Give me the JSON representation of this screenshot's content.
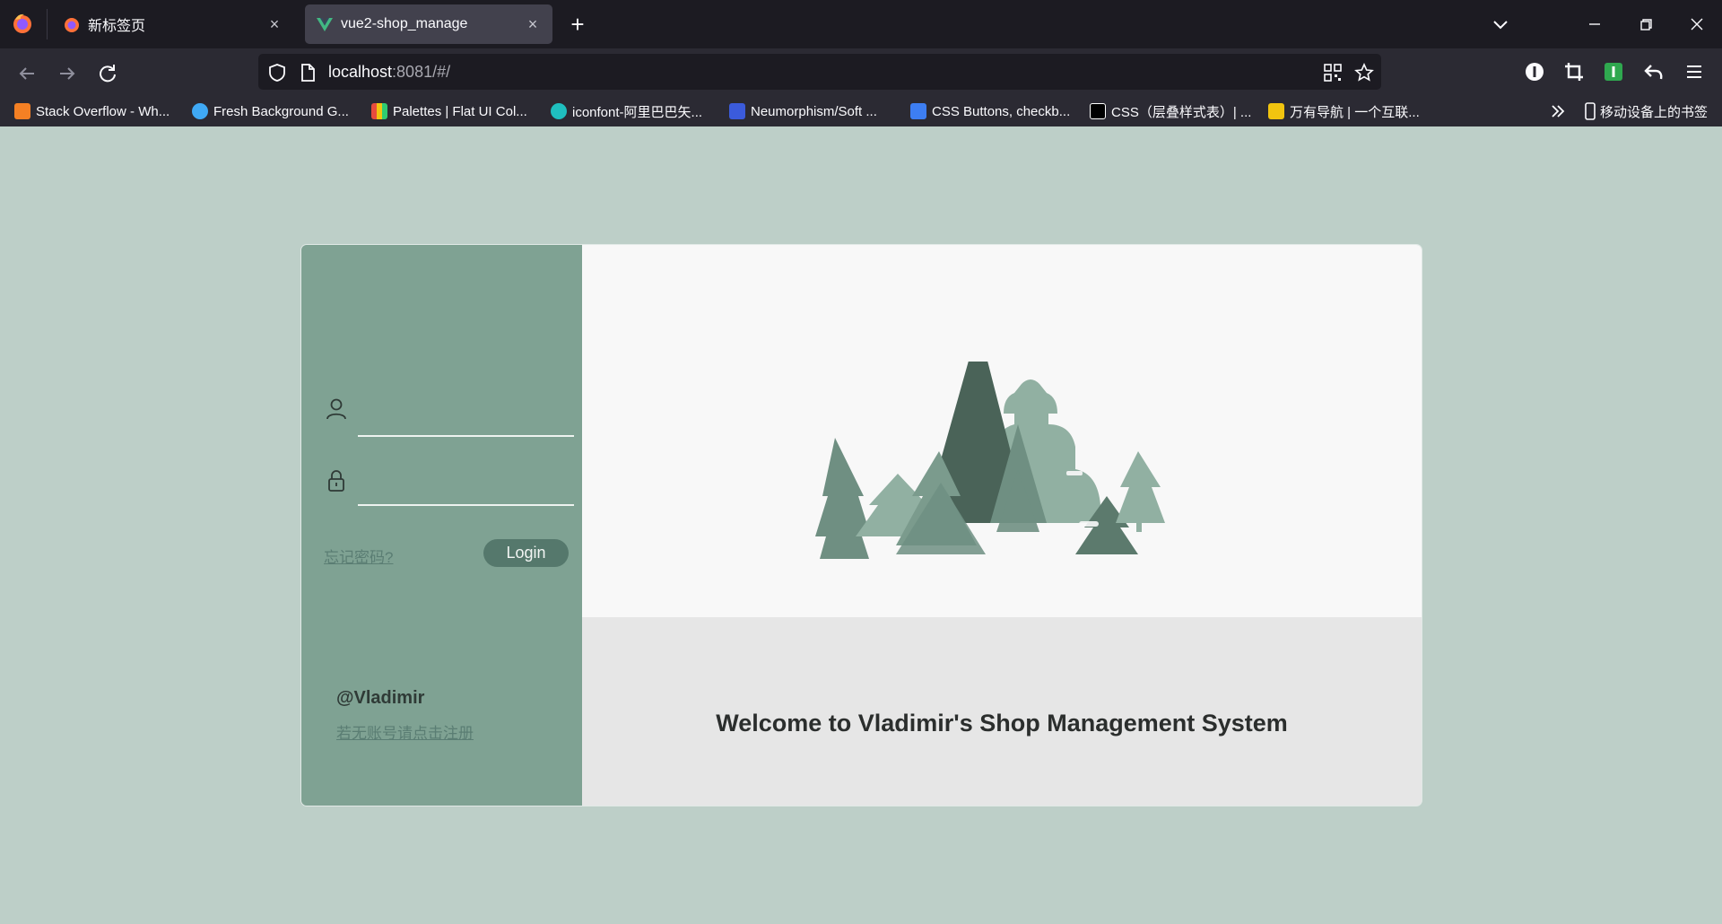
{
  "browser": {
    "tabs": [
      {
        "title": "新标签页",
        "close": "×"
      },
      {
        "title": "vue2-shop_manage",
        "close": "×"
      }
    ],
    "new_tab": "+",
    "url": {
      "host": "localhost",
      "rest": ":8081/#/"
    },
    "bookmarks": [
      {
        "label": "Stack Overflow - Wh...",
        "color": "#f48024"
      },
      {
        "label": "Fresh Background G...",
        "color": "#3fa9f5"
      },
      {
        "label": "Palettes | Flat UI Col...",
        "color": "#e84c3d"
      },
      {
        "label": "iconfont-阿里巴巴矢...",
        "color": "#1fbfbf"
      },
      {
        "label": "Neumorphism/Soft ...",
        "color": "#3b5bdb"
      },
      {
        "label": "CSS Buttons, checkb...",
        "color": "#3d7ef2"
      },
      {
        "label": "CSS（层叠样式表）| ...",
        "color": "#ffffff"
      },
      {
        "label": "万有导航 | 一个互联...",
        "color": "#f1c40f"
      }
    ],
    "mobile_bookmarks": "移动设备上的书签"
  },
  "login": {
    "username_value": "",
    "password_value": "",
    "forgot_label": "忘记密码?",
    "login_label": "Login",
    "author": "@Vladimir",
    "register_label": "若无账号请点击注册"
  },
  "hero": {
    "welcome": "Welcome to Vladimir's Shop Management System"
  },
  "colors": {
    "page_bg": "#bdcfc8",
    "panel": "#7fa293",
    "button": "#55786c",
    "tree_dark": "#4a6358",
    "tree_mid": "#6f8f82",
    "tree_light": "#91b0a2"
  }
}
